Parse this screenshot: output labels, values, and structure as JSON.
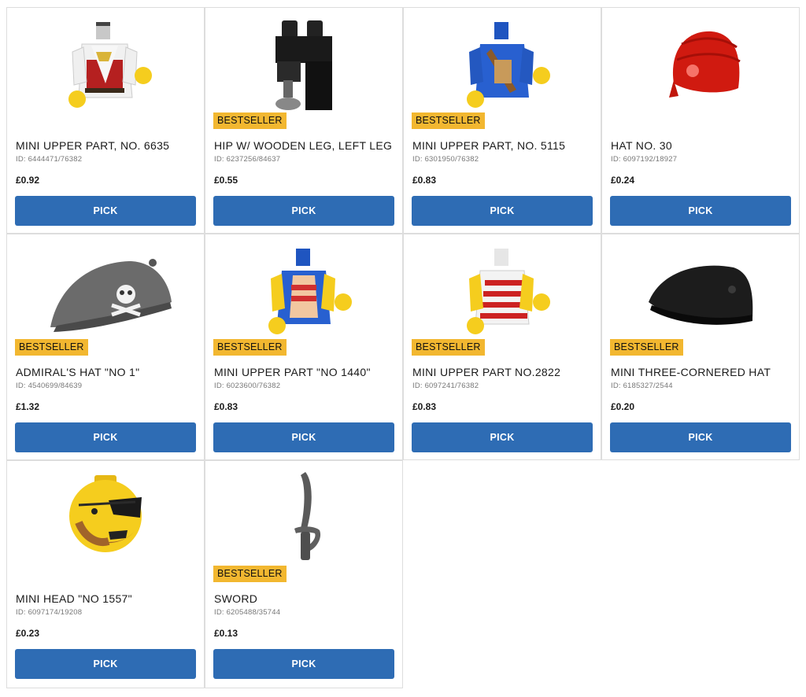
{
  "products": [
    {
      "name": "MINI UPPER PART, NO. 6635",
      "id": "ID: 6444471/76382",
      "price": "£0.92",
      "badge": "",
      "button": "PICK",
      "image": "torso-white-red-vest"
    },
    {
      "name": "HIP W/ WOODEN LEG, LEFT LEG",
      "id": "ID: 6237256/84637",
      "price": "£0.55",
      "badge": "BESTSELLER",
      "button": "PICK",
      "image": "black-legs-peg-leg"
    },
    {
      "name": "MINI UPPER PART, NO. 5115",
      "id": "ID: 6301950/76382",
      "price": "£0.83",
      "badge": "BESTSELLER",
      "button": "PICK",
      "image": "torso-blue-pirate"
    },
    {
      "name": "HAT NO. 30",
      "id": "ID: 6097192/18927",
      "price": "£0.24",
      "badge": "",
      "button": "PICK",
      "image": "red-bandana"
    },
    {
      "name": "ADMIRAL'S HAT \"NO 1\"",
      "id": "ID: 4540699/84639",
      "price": "£1.32",
      "badge": "BESTSELLER",
      "button": "PICK",
      "image": "grey-skull-hat"
    },
    {
      "name": "MINI UPPER PART \"NO 1440\"",
      "id": "ID: 6023600/76382",
      "price": "£0.83",
      "badge": "BESTSELLER",
      "button": "PICK",
      "image": "torso-blue-striped"
    },
    {
      "name": "MINI UPPER PART NO.2822",
      "id": "ID: 6097241/76382",
      "price": "£0.83",
      "badge": "BESTSELLER",
      "button": "PICK",
      "image": "torso-white-striped"
    },
    {
      "name": "MINI THREE-CORNERED HAT",
      "id": "ID: 6185327/2544",
      "price": "£0.20",
      "badge": "BESTSELLER",
      "button": "PICK",
      "image": "black-tricorn-hat"
    },
    {
      "name": "MINI HEAD \"NO 1557\"",
      "id": "ID: 6097174/19208",
      "price": "£0.23",
      "badge": "",
      "button": "PICK",
      "image": "yellow-head-eyepatch"
    },
    {
      "name": "SWORD",
      "id": "ID: 6205488/35744",
      "price": "£0.13",
      "badge": "BESTSELLER",
      "button": "PICK",
      "image": "grey-sword"
    }
  ],
  "colors": {
    "button": "#2e6cb4",
    "badge": "#f2b730",
    "border": "#dddddd"
  }
}
